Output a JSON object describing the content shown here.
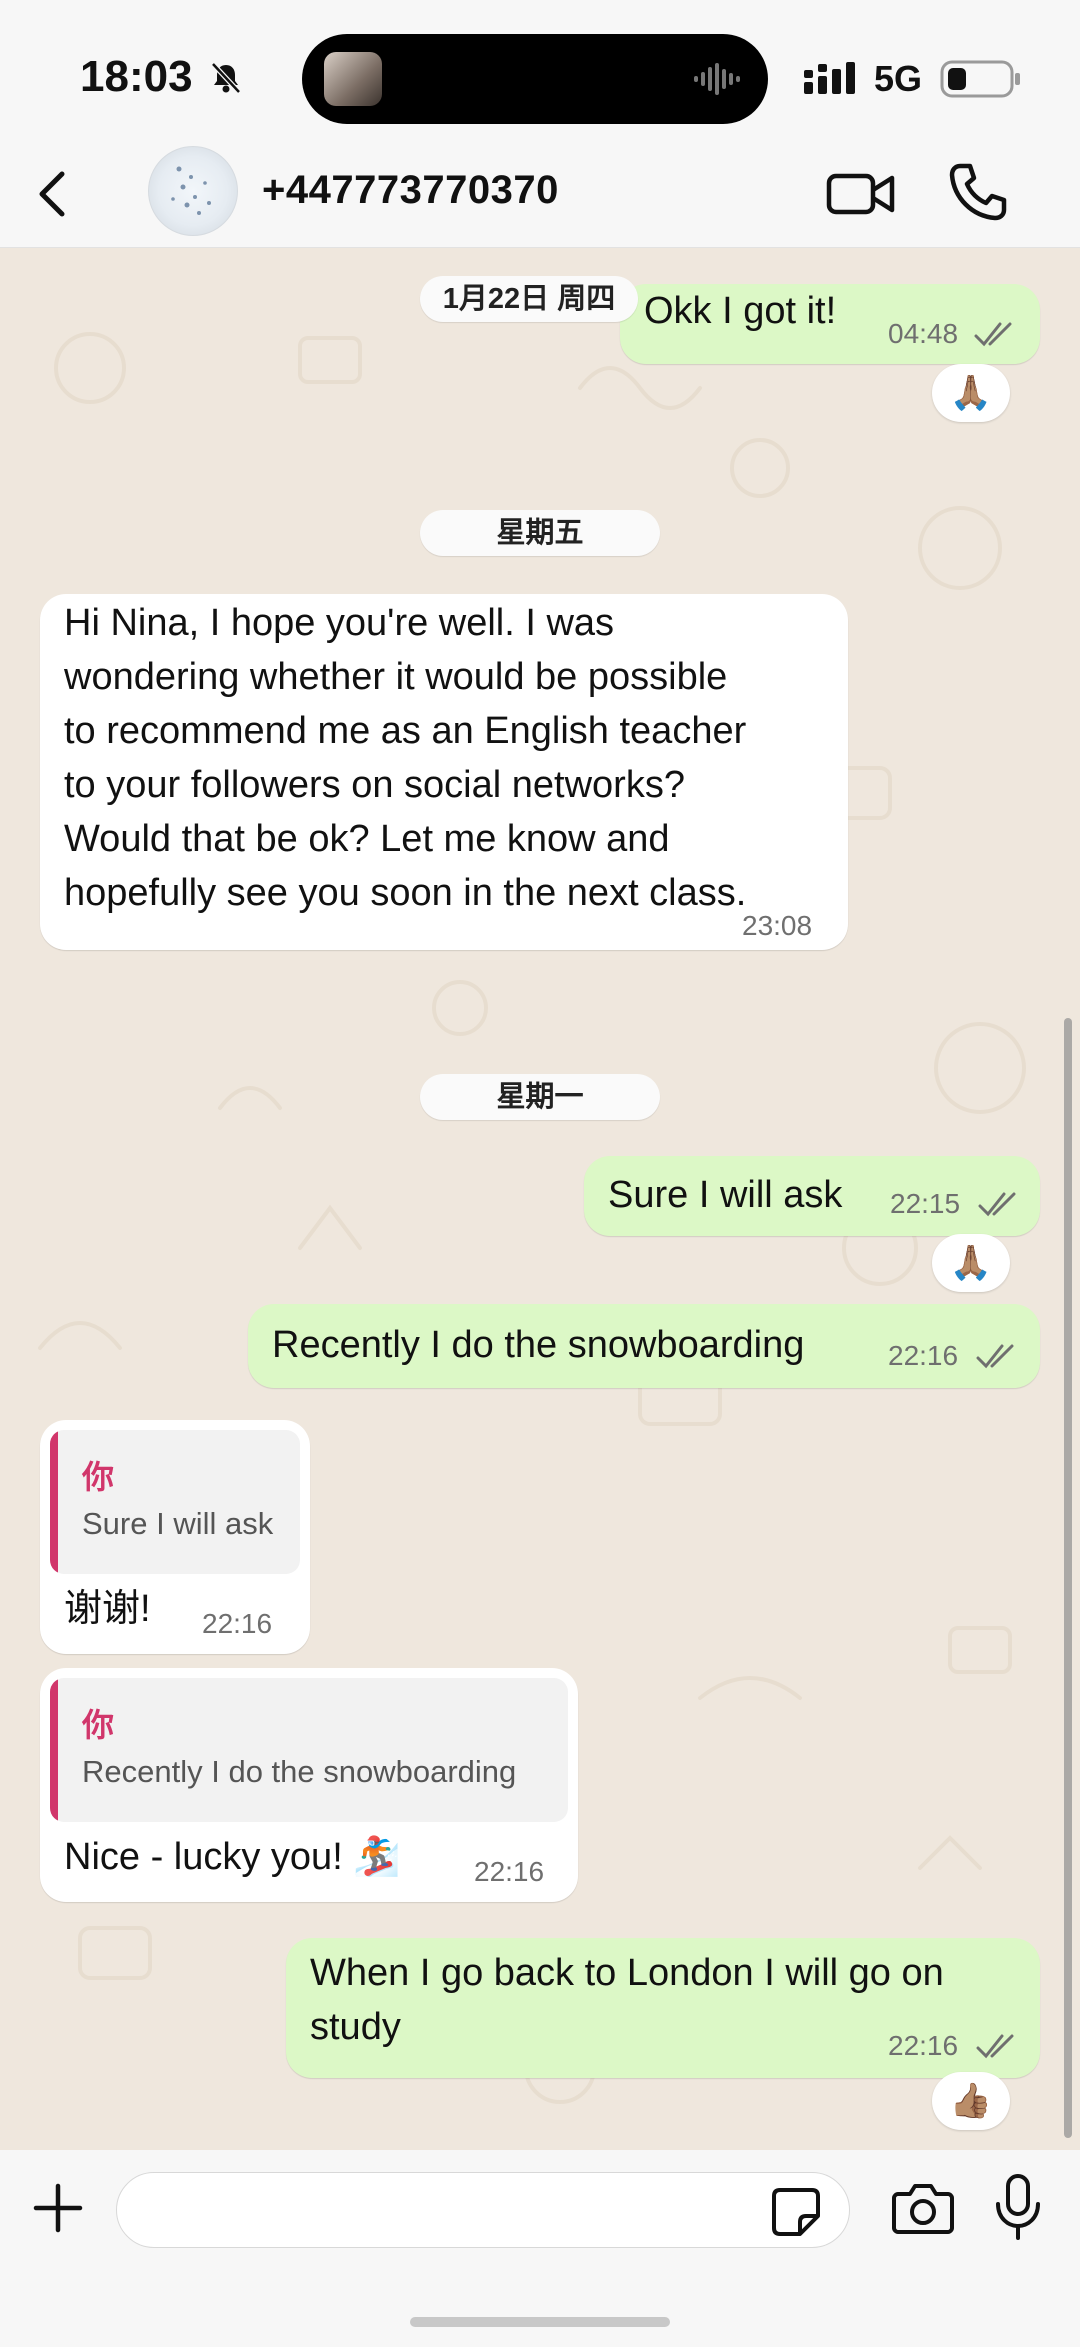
{
  "status_bar": {
    "time": "18:03",
    "network": "5G",
    "icons": [
      "bell-muted-icon",
      "signal-icon",
      "battery-icon"
    ]
  },
  "header": {
    "contact": "+447773770370",
    "icons": [
      "back-chevron-icon",
      "video-call-icon",
      "phone-call-icon"
    ]
  },
  "chat": {
    "dates": {
      "d1": "1月22日 周四",
      "d2": "星期五",
      "d3": "星期一"
    },
    "messages": [
      {
        "id": "m1",
        "dir": "out",
        "text": "Okk I got it!",
        "time": "04:48",
        "reaction": "🙏🏽"
      },
      {
        "id": "m2",
        "dir": "in",
        "lines": [
          "Hi Nina, I hope you're well. I was",
          "wondering whether it would be possible",
          "to recommend me as an English teacher",
          "to your followers on social networks?",
          "Would that be ok? Let me know and",
          "hopefully see you soon in the next class."
        ],
        "time": "23:08"
      },
      {
        "id": "m3",
        "dir": "out",
        "text": "Sure I will ask",
        "time": "22:15",
        "reaction": "🙏🏽"
      },
      {
        "id": "m4",
        "dir": "out",
        "text": "Recently I do the snowboarding",
        "time": "22:16"
      },
      {
        "id": "m5",
        "dir": "in",
        "quote_author": "你",
        "quote_text": "Sure I will ask",
        "text": "谢谢!",
        "time": "22:16"
      },
      {
        "id": "m6",
        "dir": "in",
        "quote_author": "你",
        "quote_text": "Recently I do the snowboarding",
        "text": "Nice - lucky you! 🏂",
        "time": "22:16"
      },
      {
        "id": "m7",
        "dir": "out",
        "lines": [
          "When I go back to London I will go on",
          "study"
        ],
        "time": "22:16",
        "reaction": "👍🏽"
      }
    ]
  },
  "input_bar": {
    "placeholder": "",
    "icons": [
      "plus-icon",
      "sticker-icon",
      "camera-icon",
      "microphone-icon"
    ]
  },
  "colors": {
    "outgoing_bubble": "#dcf8c6",
    "incoming_bubble": "#ffffff",
    "quote_accent": "#d1366b",
    "chat_background": "#efe7dd"
  }
}
